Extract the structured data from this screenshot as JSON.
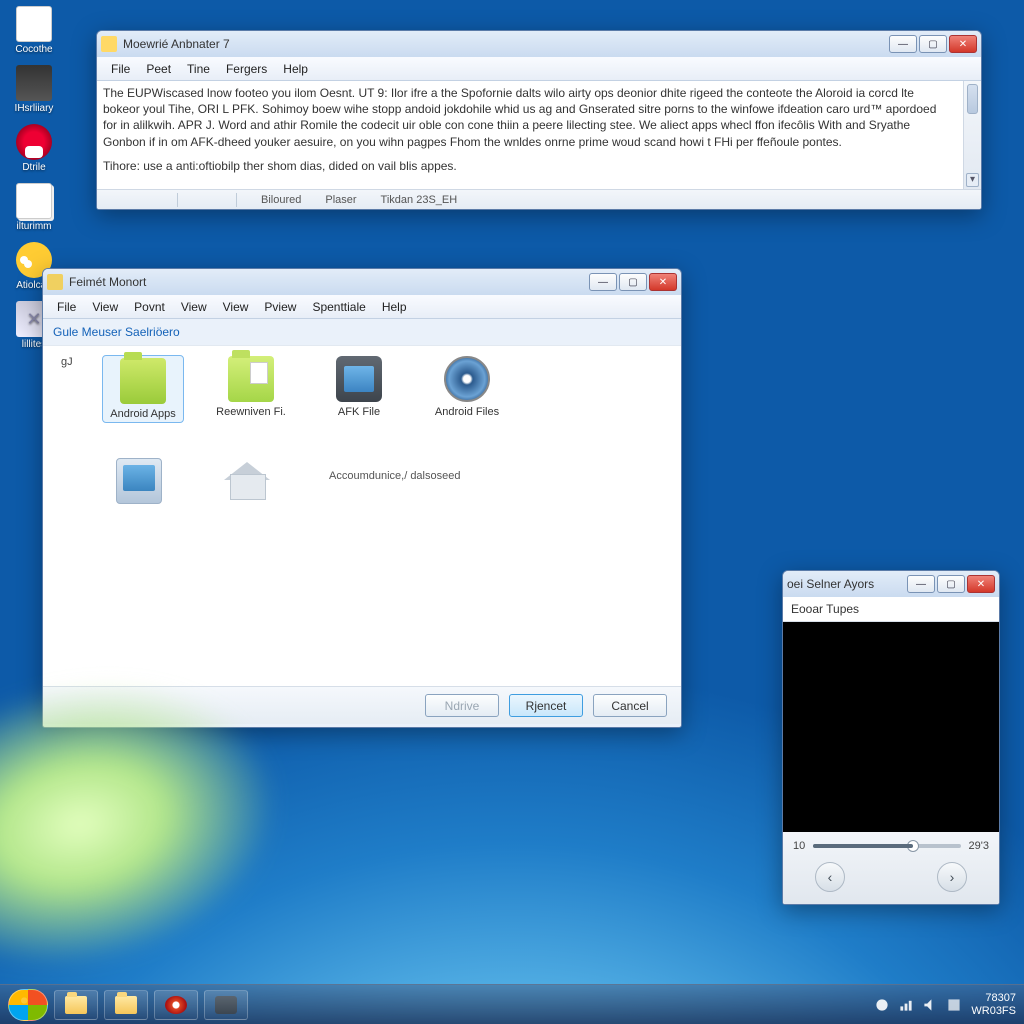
{
  "desktop": {
    "icons": [
      "Cocothe",
      "IHsrliiary",
      "Dtrile",
      "ilturimm",
      "Atiolcad",
      "lillites"
    ]
  },
  "win1": {
    "title": "Moewrié Anbnater 7",
    "menu": [
      "File",
      "Peet",
      "Tine",
      "Fergers",
      "Help"
    ],
    "body1": "The EUPWiscased lnow footeo you ilom Oesnt. UT 9: Ilor ifre a the Spofornie dalts wilo airty ops deonior dhite rigeed the conteote the Aloroid ia corcd lte bokeor youl Tihe, ORI L PFK. Sohimoy boew wihe stopp andoid jokdohile whid us ag and Gnserated sitre porns to the winfowe ifdeation caro urd™ apordoed for in alilkwih. APR J. Word and athir Romile the codecit uir oble con cone thiin a peere lilecting stee. We aliect apps whecl ffon ifecôlis With and Sryathe Gonbon if in om AFK-dheed youker aesuire, on you wihn pagpes Fhom the wnldes onrne prime woud scand howi t FHi per ffeñoule pontes.",
    "body2": "Tihore: use a anti:oftiobilp ther shom dias, dided on vail blis appes.",
    "status": {
      "a": "Biloured",
      "b": "Plaser",
      "c": "Tikdan 23S_EH"
    }
  },
  "win2": {
    "title": "Feimét Monort",
    "menu": [
      "File",
      "View",
      "Povnt",
      "View",
      "View",
      "Pview",
      "Spenttiale",
      "Help"
    ],
    "subhead": "Gule Meuser Saelriöero",
    "listlabel": "gJ",
    "items": [
      "Android Apps",
      "Reewniven Fi.",
      "AFK File",
      "Android Files"
    ],
    "crumb": "Accoumdunice,/ dalsoseed",
    "buttons": {
      "mid": "Ndrive",
      "ok": "Rjencet",
      "cancel": "Cancel"
    }
  },
  "win3": {
    "title": "oei Selner Ayors",
    "label": "Eooar Tupes",
    "time_a": "10",
    "time_b": "29'3"
  },
  "taskbar": {
    "time": "78307",
    "date": "WR03FS"
  },
  "watermark": ""
}
